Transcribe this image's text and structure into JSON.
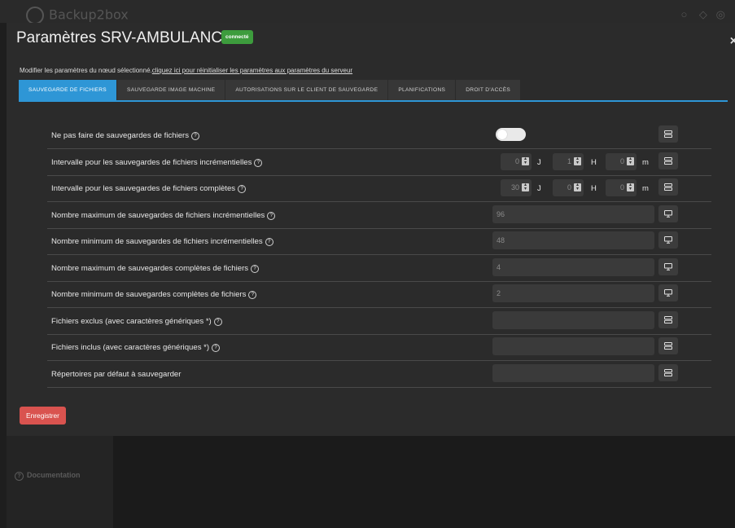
{
  "background": {
    "app_name": "Backup2box",
    "sidebar_documentation": "Documentation"
  },
  "modal": {
    "title": "Paramètres SRV-AMBULANCE",
    "status_badge": "connecté",
    "close_label": "×",
    "hint_text": "Modifier les paramètres du nœud sélectionné.",
    "hint_link": "cliquez ici pour réinitialiser les paramètres aux paramètres du serveur"
  },
  "tabs": [
    {
      "label": "SAUVEGARDE DE FICHIERS",
      "active": true
    },
    {
      "label": "SAUVEGARDE IMAGE MACHINE",
      "active": false
    },
    {
      "label": "AUTORISATIONS SUR LE CLIENT DE SAUVEGARDE",
      "active": false
    },
    {
      "label": "PLANIFICATIONS",
      "active": false
    },
    {
      "label": "DROIT D'ACCÈS",
      "active": false
    }
  ],
  "settings": {
    "no_file_backups": {
      "label": "Ne pas faire de sauvegardes de fichiers",
      "enabled": false,
      "scope_icon": "server-icon"
    },
    "incr_interval": {
      "label": "Intervalle pour les sauvegardes de fichiers incrémentielles",
      "days": "0",
      "hours": "1",
      "minutes": "0",
      "unit_days": "J",
      "unit_hours": "H",
      "unit_minutes": "m",
      "scope_icon": "server-icon"
    },
    "full_interval": {
      "label": "Intervalle pour les sauvegardes de fichiers complètes",
      "days": "30",
      "hours": "0",
      "minutes": "0",
      "unit_days": "J",
      "unit_hours": "H",
      "unit_minutes": "m",
      "scope_icon": "server-icon"
    },
    "max_incr": {
      "label": "Nombre maximum de sauvegardes de fichiers incrémentielles",
      "value": "96",
      "scope_icon": "monitor-icon"
    },
    "min_incr": {
      "label": "Nombre minimum de sauvegardes de fichiers incrémentielles",
      "value": "48",
      "scope_icon": "monitor-icon"
    },
    "max_full": {
      "label": "Nombre maximum de sauvegardes complètes de fichiers",
      "value": "4",
      "scope_icon": "monitor-icon"
    },
    "min_full": {
      "label": "Nombre minimum de sauvegardes complètes de fichiers",
      "value": "2",
      "scope_icon": "monitor-icon"
    },
    "excluded": {
      "label": "Fichiers exclus (avec caractères génériques *)",
      "value": "",
      "scope_icon": "server-icon"
    },
    "included": {
      "label": "Fichiers inclus (avec caractères génériques *)",
      "value": "",
      "scope_icon": "server-icon"
    },
    "default_dirs": {
      "label": "Répertoires par défaut à sauvegarder",
      "value": "",
      "scope_icon": "server-icon"
    }
  },
  "save_button": "Enregistrer",
  "colors": {
    "accent": "#2e96d6",
    "badge": "#3d9c3d",
    "save": "#d9534f"
  }
}
